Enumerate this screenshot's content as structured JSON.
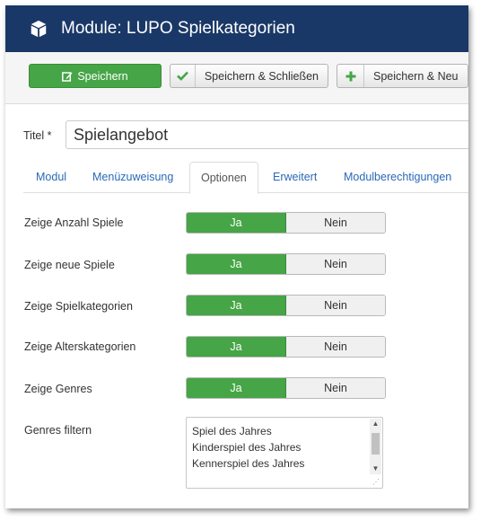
{
  "header": {
    "title": "Module: LUPO Spielkategorien"
  },
  "toolbar": {
    "save_label": "Speichern",
    "save_close_label": "Speichern & Schließen",
    "save_new_label": "Speichern & Neu"
  },
  "titel": {
    "label": "Titel *",
    "value": "Spielangebot"
  },
  "tabs": [
    {
      "label": "Modul"
    },
    {
      "label": "Menüzuweisung"
    },
    {
      "label": "Optionen"
    },
    {
      "label": "Erweitert"
    },
    {
      "label": "Modulberechtigungen"
    }
  ],
  "options": [
    {
      "label": "Zeige Anzahl Spiele",
      "yes": "Ja",
      "no": "Nein",
      "selected": "Ja"
    },
    {
      "label": "Zeige neue Spiele",
      "yes": "Ja",
      "no": "Nein",
      "selected": "Ja"
    },
    {
      "label": "Zeige Spielkategorien",
      "yes": "Ja",
      "no": "Nein",
      "selected": "Ja"
    },
    {
      "label": "Zeige Alterskategorien",
      "yes": "Ja",
      "no": "Nein",
      "selected": "Ja"
    },
    {
      "label": "Zeige Genres",
      "yes": "Ja",
      "no": "Nein",
      "selected": "Ja"
    }
  ],
  "genres_filter": {
    "label": "Genres filtern",
    "options": [
      "Spiel des Jahres",
      "Kinderspiel des Jahres",
      "Kennerspiel des Jahres"
    ]
  },
  "colors": {
    "header": "#1a3867",
    "success": "#46a546",
    "link": "#2a69b8"
  }
}
